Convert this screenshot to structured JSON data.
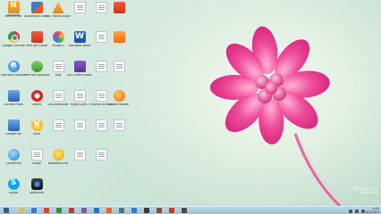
{
  "desktop": {
    "icons": [
      {
        "label": "Recycle Bin",
        "glyph": "g-grey"
      },
      {
        "label": "Google Chrome",
        "glyph": "g-chrome"
      },
      {
        "label": "Internet Explorer",
        "glyph": "g-ie"
      },
      {
        "label": "Control Panel",
        "glyph": "g-blue"
      },
      {
        "label": "Google file",
        "glyph": "g-blue"
      },
      {
        "label": "Connectify",
        "glyph": "g-globe"
      },
      {
        "label": "Skype",
        "glyph": "g-skype"
      },
      {
        "label": "Winamp",
        "glyph": "g-n"
      },
      {
        "label": "Ashampoo Burning Studio",
        "glyph": "g-photo"
      },
      {
        "label": "Infix pdf Editor",
        "glyph": "g-red"
      },
      {
        "label": "Internet Download Manager",
        "glyph": "g-green"
      },
      {
        "label": "Opera",
        "glyph": "g-opera"
      },
      {
        "label": "Vuze",
        "glyph": "g-v"
      },
      {
        "label": "Skype",
        "glyph": "g-doc"
      },
      {
        "label": "SpeedFan",
        "glyph": "g-cam"
      },
      {
        "label": "VLC media player",
        "glyph": "g-vlc"
      },
      {
        "label": "Picasa 3",
        "glyph": "g-flower"
      },
      {
        "label": "Jing",
        "glyph": "g-doc"
      },
      {
        "label": "DVDVideoSoft",
        "glyph": "g-doc"
      },
      {
        "label": "",
        "glyph": "g-doc"
      },
      {
        "label": "Windows Live",
        "glyph": "g-gold"
      },
      {
        "label": "",
        "glyph": "g-doc"
      },
      {
        "label": "Microsoft Word",
        "glyph": "g-word"
      },
      {
        "label": "AVS Video Editor",
        "glyph": "g-purple"
      },
      {
        "label": "HyperCam 2",
        "glyph": "g-doc"
      },
      {
        "label": "",
        "glyph": "g-doc"
      },
      {
        "label": "",
        "glyph": "g-doc"
      },
      {
        "label": "",
        "glyph": "g-doc"
      },
      {
        "label": "",
        "glyph": "g-doc"
      },
      {
        "label": "",
        "glyph": "g-doc"
      },
      {
        "label": "Mozilla Firefox",
        "glyph": "g-doc"
      },
      {
        "label": "",
        "glyph": "g-doc"
      },
      {
        "label": "",
        "glyph": "g-doc"
      },
      {
        "label": "",
        "glyph": "g-red"
      },
      {
        "label": "",
        "glyph": "g-orange"
      },
      {
        "label": "",
        "glyph": "g-doc"
      },
      {
        "label": "Adobe Reader",
        "glyph": "g-fire"
      },
      {
        "label": "",
        "glyph": "g-doc"
      }
    ],
    "watermark": {
      "line1": "Windows 8.1",
      "line2": "Build 9600"
    }
  },
  "taskbar": {
    "apps": [
      {
        "name": "start",
        "color": "#2b5d8a"
      },
      {
        "name": "explorer",
        "color": "#e9b74a"
      },
      {
        "name": "ie",
        "color": "#2f7fd6"
      },
      {
        "name": "chrome",
        "color": "#d64235"
      },
      {
        "name": "app1",
        "color": "#3a8a3a"
      },
      {
        "name": "app2",
        "color": "#c0392b"
      },
      {
        "name": "app3",
        "color": "#7a5c9a"
      },
      {
        "name": "app4",
        "color": "#2f6fc9"
      },
      {
        "name": "app5",
        "color": "#e06a1a"
      },
      {
        "name": "app6",
        "color": "#5a6e80"
      },
      {
        "name": "app7",
        "color": "#2f7fd6"
      },
      {
        "name": "app8",
        "color": "#3a3a3a"
      },
      {
        "name": "app9",
        "color": "#8b4a2a"
      },
      {
        "name": "app10",
        "color": "#c0392b"
      },
      {
        "name": "app11",
        "color": "#4a4a4a"
      }
    ],
    "clock": {
      "time": "4:05",
      "date": "6/1/2015"
    }
  }
}
